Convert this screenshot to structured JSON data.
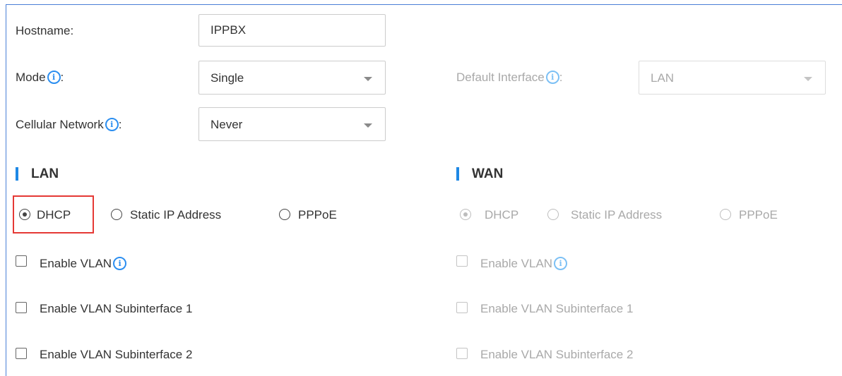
{
  "general": {
    "hostname_label": "Hostname:",
    "hostname_value": "IPPBX",
    "mode_label": "Mode",
    "mode_value": "Single",
    "default_interface_label": "Default Interface",
    "default_interface_value": "LAN",
    "cellular_label": "Cellular Network",
    "cellular_value": "Never",
    "colon": ":",
    "info_glyph": "i"
  },
  "lan": {
    "title": "LAN",
    "radios": [
      "DHCP",
      "Static IP Address",
      "PPPoE"
    ],
    "selected": "DHCP",
    "checkboxes": [
      "Enable VLAN",
      "Enable VLAN Subinterface 1",
      "Enable VLAN Subinterface 2"
    ]
  },
  "wan": {
    "title": "WAN",
    "radios": [
      "DHCP",
      "Static IP Address",
      "PPPoE"
    ],
    "selected": "DHCP",
    "checkboxes": [
      "Enable VLAN",
      "Enable VLAN Subinterface 1",
      "Enable VLAN Subinterface 2"
    ],
    "disabled": true
  },
  "colors": {
    "accent": "#1e88e5",
    "highlight": "#e53935",
    "info_icon": "#2b8ef0",
    "disabled_text": "#a9a9a9"
  }
}
